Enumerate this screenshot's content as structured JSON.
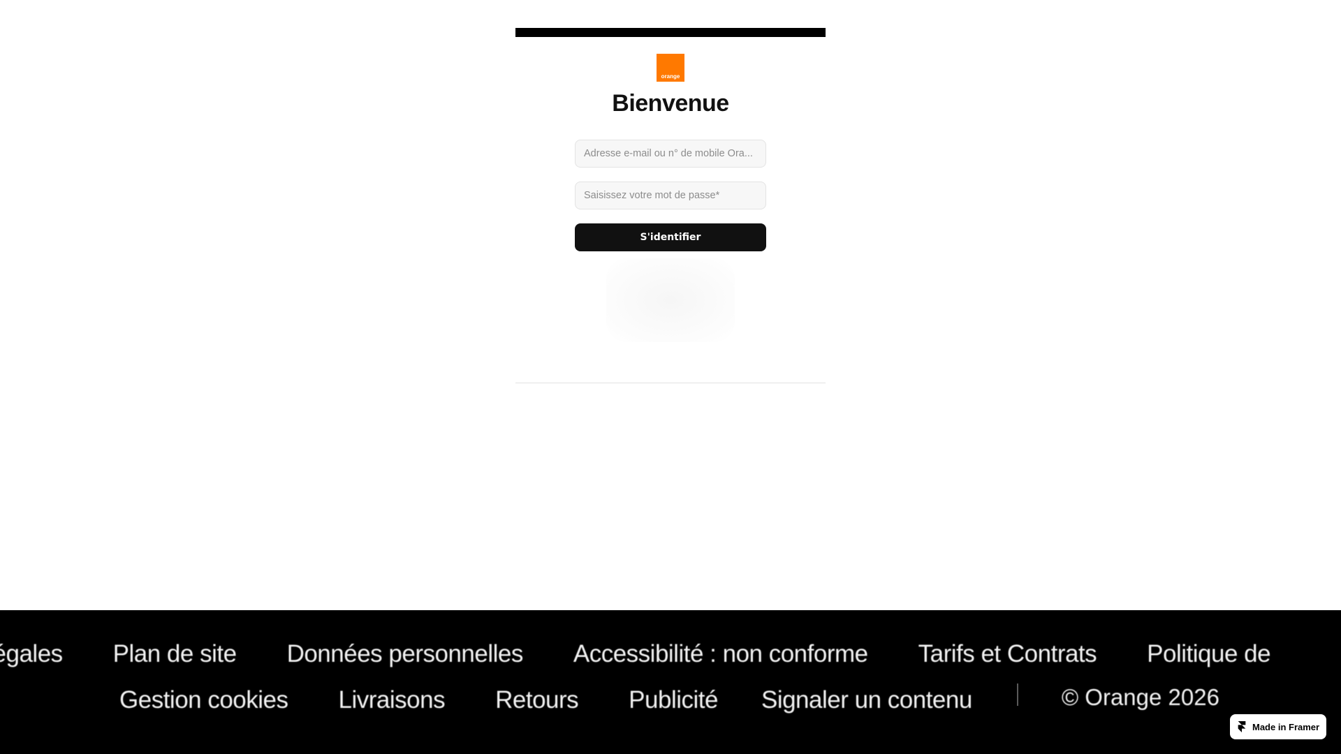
{
  "login": {
    "logo_text": "orange",
    "title": "Bienvenue",
    "email_placeholder": "Adresse e-mail ou n° de mobile Ora...",
    "password_placeholder": "Saisissez votre mot de passe*",
    "submit_label": "S'identifier"
  },
  "footer": {
    "row1": [
      "Mentions légales",
      "Plan de site",
      "Données personnelles",
      "Accessibilité : non conforme",
      "Tarifs et Contrats",
      "Politique de"
    ],
    "row2": [
      "Gestion cookies",
      "Livraisons",
      "Retours",
      "Publicité",
      "Signaler un contenu"
    ],
    "copyright": "© Orange 2026"
  },
  "badge": {
    "label": "Made in Framer",
    "icon": "framer-icon"
  },
  "colors": {
    "brand_orange": "#ff7900",
    "button_bg": "#111111",
    "footer_bg": "#000000"
  }
}
